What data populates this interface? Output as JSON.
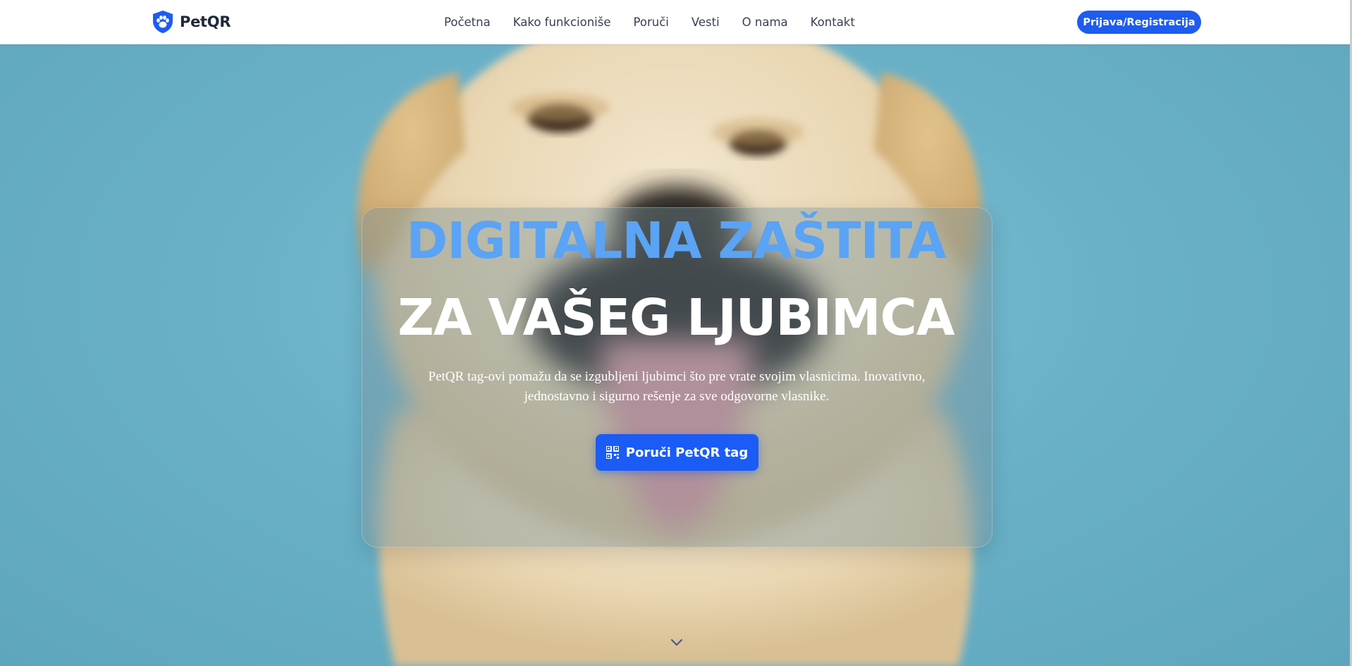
{
  "navbar": {
    "brand": "PetQR",
    "links": [
      "Početna",
      "Kako funkcioniše",
      "Poruči",
      "Vesti",
      "O nama",
      "Kontakt"
    ],
    "login_label": "Prijava/Registracija"
  },
  "hero": {
    "title_line1": "DIGITALNA ZAŠTITA",
    "title_line2": "ZA VAŠEG LJUBIMCA",
    "description": "PetQR tag-ovi pomažu da se izgubljeni ljubimci što pre vrate svojim vlasnicima. Inovativno, jednostavno i sigurno rešenje za sve odgovorne vlasnike.",
    "cta_label": "Poruči PetQR tag"
  },
  "icons": {
    "logo": "shield-paw-icon",
    "cta": "qr-code-icon",
    "scroll": "chevron-down-icon"
  },
  "colors": {
    "primary": "#1a5cf5",
    "title_accent": "#5aa3f5",
    "hero_background": "#6ab1c8",
    "nav_text": "#374151"
  }
}
